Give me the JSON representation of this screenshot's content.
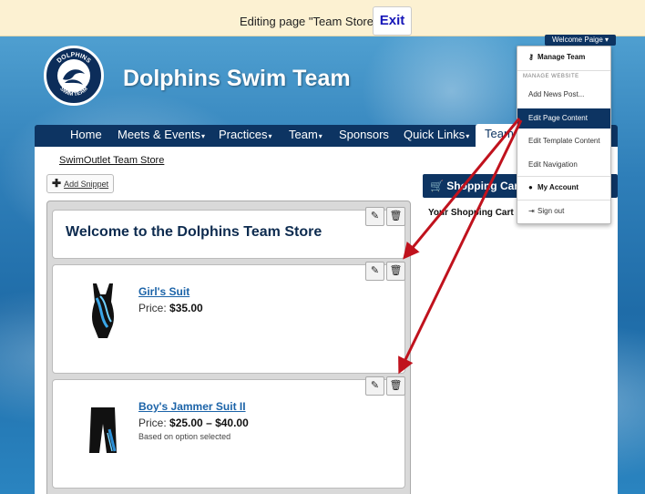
{
  "edit_bar": {
    "text": "Editing page \"Team Store\"",
    "exit_label": "Exit"
  },
  "header": {
    "title": "Dolphins Swim Team",
    "logo_top": "DOLPHINS",
    "logo_bottom": "SWIM TEAM"
  },
  "nav": {
    "items": [
      {
        "label": "Home",
        "caret": ""
      },
      {
        "label": "Meets & Events",
        "caret": "▾"
      },
      {
        "label": "Practices",
        "caret": "▾"
      },
      {
        "label": "Team",
        "caret": "▾"
      },
      {
        "label": "Sponsors",
        "caret": ""
      },
      {
        "label": "Quick Links",
        "caret": "▾"
      },
      {
        "label": "Team St",
        "caret": ""
      }
    ]
  },
  "breadcrumb": "SwimOutlet Team Store",
  "add_snippet_label": "Add Snippet",
  "welcome_snippet": "Welcome to the Dolphins Team Store",
  "products": [
    {
      "name": "Girl's Suit",
      "price_label": "Price:",
      "price": "$35.00",
      "note": ""
    },
    {
      "name": "Boy's Jammer Suit II",
      "price_label": "Price:",
      "price": "$25.00 – $40.00",
      "note": "Based on option selected"
    }
  ],
  "cart": {
    "title": "Shopping Cart (",
    "empty_text": "Your Shopping Cart is"
  },
  "user_menu": {
    "button_label": "Welcome Paige ▾",
    "manage_team": "Manage Team",
    "heading": "MANAGE WEBSITE",
    "add_news": "Add News Post...",
    "edit_page": "Edit Page Content",
    "edit_template": "Edit Template Content",
    "edit_nav": "Edit Navigation",
    "my_account": "My Account",
    "sign_out": "Sign out"
  },
  "colors": {
    "navy": "#0d3462",
    "arrow_red": "#c0121d",
    "edit_bar_bg": "#fcf1d2"
  },
  "icons": {
    "edit": "pencil-icon",
    "delete": "trash-icon",
    "cart": "cart-icon",
    "key": "key-icon",
    "person": "person-icon",
    "signout": "signout-icon",
    "plus": "plus-icon"
  }
}
